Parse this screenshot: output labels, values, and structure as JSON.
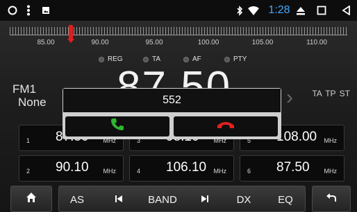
{
  "status_bar": {
    "icons": [
      "home-circle-icon",
      "more-vert-icon",
      "image-icon",
      "bluetooth-icon",
      "wifi-icon",
      "eject-icon",
      "recents-square-icon",
      "back-triangle-icon"
    ],
    "time": "1:28",
    "time_color": "#44a9ff"
  },
  "tuner": {
    "scale_labels": [
      "85.00",
      "90.00",
      "95.00",
      "100.00",
      "105.00",
      "110.00"
    ],
    "current_frequency_mhz": 87.5,
    "needle_color": "#e21d1d"
  },
  "indicators": {
    "reg": "REG",
    "ta": "TA",
    "af": "AF",
    "pty": "PTY"
  },
  "band_info": {
    "band": "FM1",
    "station_name": "None",
    "big_frequency": "87.50",
    "flags": "TA TP ST"
  },
  "presets": [
    {
      "num": "1",
      "freq": "87.50",
      "unit": "MHz"
    },
    {
      "num": "3",
      "freq": "98.10",
      "unit": "MHz"
    },
    {
      "num": "5",
      "freq": "108.00",
      "unit": "MHz"
    },
    {
      "num": "2",
      "freq": "90.10",
      "unit": "MHz"
    },
    {
      "num": "4",
      "freq": "106.10",
      "unit": "MHz"
    },
    {
      "num": "6",
      "freq": "87.50",
      "unit": "MHz"
    }
  ],
  "bottom_bar": {
    "home_icon": "home-icon",
    "as": "AS",
    "prev_icon": "skip-previous-icon",
    "band": "BAND",
    "next_icon": "skip-next-icon",
    "dx": "DX",
    "eq": "EQ",
    "back_icon": "return-icon"
  },
  "call_dialog": {
    "caller": "552",
    "answer_icon": "phone-answer-icon",
    "answer_color": "#2fb62f",
    "hangup_icon": "phone-hangup-icon",
    "hangup_color": "#e32020"
  }
}
